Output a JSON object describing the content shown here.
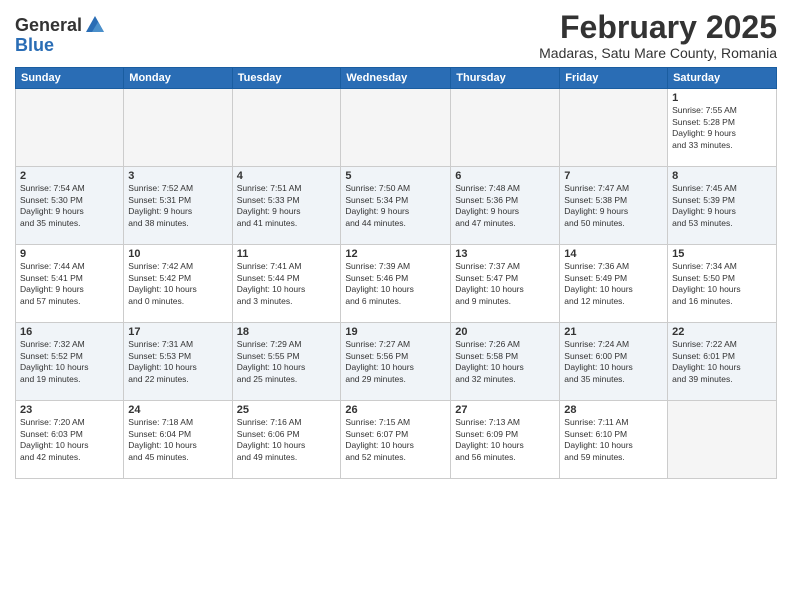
{
  "app": {
    "logo_general": "General",
    "logo_blue": "Blue"
  },
  "header": {
    "title": "February 2025",
    "subtitle": "Madaras, Satu Mare County, Romania"
  },
  "days_of_week": [
    "Sunday",
    "Monday",
    "Tuesday",
    "Wednesday",
    "Thursday",
    "Friday",
    "Saturday"
  ],
  "weeks": [
    {
      "days": [
        {
          "date": "",
          "info": ""
        },
        {
          "date": "",
          "info": ""
        },
        {
          "date": "",
          "info": ""
        },
        {
          "date": "",
          "info": ""
        },
        {
          "date": "",
          "info": ""
        },
        {
          "date": "",
          "info": ""
        },
        {
          "date": "1",
          "info": "Sunrise: 7:55 AM\nSunset: 5:28 PM\nDaylight: 9 hours\nand 33 minutes."
        }
      ]
    },
    {
      "days": [
        {
          "date": "2",
          "info": "Sunrise: 7:54 AM\nSunset: 5:30 PM\nDaylight: 9 hours\nand 35 minutes."
        },
        {
          "date": "3",
          "info": "Sunrise: 7:52 AM\nSunset: 5:31 PM\nDaylight: 9 hours\nand 38 minutes."
        },
        {
          "date": "4",
          "info": "Sunrise: 7:51 AM\nSunset: 5:33 PM\nDaylight: 9 hours\nand 41 minutes."
        },
        {
          "date": "5",
          "info": "Sunrise: 7:50 AM\nSunset: 5:34 PM\nDaylight: 9 hours\nand 44 minutes."
        },
        {
          "date": "6",
          "info": "Sunrise: 7:48 AM\nSunset: 5:36 PM\nDaylight: 9 hours\nand 47 minutes."
        },
        {
          "date": "7",
          "info": "Sunrise: 7:47 AM\nSunset: 5:38 PM\nDaylight: 9 hours\nand 50 minutes."
        },
        {
          "date": "8",
          "info": "Sunrise: 7:45 AM\nSunset: 5:39 PM\nDaylight: 9 hours\nand 53 minutes."
        }
      ]
    },
    {
      "days": [
        {
          "date": "9",
          "info": "Sunrise: 7:44 AM\nSunset: 5:41 PM\nDaylight: 9 hours\nand 57 minutes."
        },
        {
          "date": "10",
          "info": "Sunrise: 7:42 AM\nSunset: 5:42 PM\nDaylight: 10 hours\nand 0 minutes."
        },
        {
          "date": "11",
          "info": "Sunrise: 7:41 AM\nSunset: 5:44 PM\nDaylight: 10 hours\nand 3 minutes."
        },
        {
          "date": "12",
          "info": "Sunrise: 7:39 AM\nSunset: 5:46 PM\nDaylight: 10 hours\nand 6 minutes."
        },
        {
          "date": "13",
          "info": "Sunrise: 7:37 AM\nSunset: 5:47 PM\nDaylight: 10 hours\nand 9 minutes."
        },
        {
          "date": "14",
          "info": "Sunrise: 7:36 AM\nSunset: 5:49 PM\nDaylight: 10 hours\nand 12 minutes."
        },
        {
          "date": "15",
          "info": "Sunrise: 7:34 AM\nSunset: 5:50 PM\nDaylight: 10 hours\nand 16 minutes."
        }
      ]
    },
    {
      "days": [
        {
          "date": "16",
          "info": "Sunrise: 7:32 AM\nSunset: 5:52 PM\nDaylight: 10 hours\nand 19 minutes."
        },
        {
          "date": "17",
          "info": "Sunrise: 7:31 AM\nSunset: 5:53 PM\nDaylight: 10 hours\nand 22 minutes."
        },
        {
          "date": "18",
          "info": "Sunrise: 7:29 AM\nSunset: 5:55 PM\nDaylight: 10 hours\nand 25 minutes."
        },
        {
          "date": "19",
          "info": "Sunrise: 7:27 AM\nSunset: 5:56 PM\nDaylight: 10 hours\nand 29 minutes."
        },
        {
          "date": "20",
          "info": "Sunrise: 7:26 AM\nSunset: 5:58 PM\nDaylight: 10 hours\nand 32 minutes."
        },
        {
          "date": "21",
          "info": "Sunrise: 7:24 AM\nSunset: 6:00 PM\nDaylight: 10 hours\nand 35 minutes."
        },
        {
          "date": "22",
          "info": "Sunrise: 7:22 AM\nSunset: 6:01 PM\nDaylight: 10 hours\nand 39 minutes."
        }
      ]
    },
    {
      "days": [
        {
          "date": "23",
          "info": "Sunrise: 7:20 AM\nSunset: 6:03 PM\nDaylight: 10 hours\nand 42 minutes."
        },
        {
          "date": "24",
          "info": "Sunrise: 7:18 AM\nSunset: 6:04 PM\nDaylight: 10 hours\nand 45 minutes."
        },
        {
          "date": "25",
          "info": "Sunrise: 7:16 AM\nSunset: 6:06 PM\nDaylight: 10 hours\nand 49 minutes."
        },
        {
          "date": "26",
          "info": "Sunrise: 7:15 AM\nSunset: 6:07 PM\nDaylight: 10 hours\nand 52 minutes."
        },
        {
          "date": "27",
          "info": "Sunrise: 7:13 AM\nSunset: 6:09 PM\nDaylight: 10 hours\nand 56 minutes."
        },
        {
          "date": "28",
          "info": "Sunrise: 7:11 AM\nSunset: 6:10 PM\nDaylight: 10 hours\nand 59 minutes."
        },
        {
          "date": "",
          "info": ""
        }
      ]
    }
  ]
}
